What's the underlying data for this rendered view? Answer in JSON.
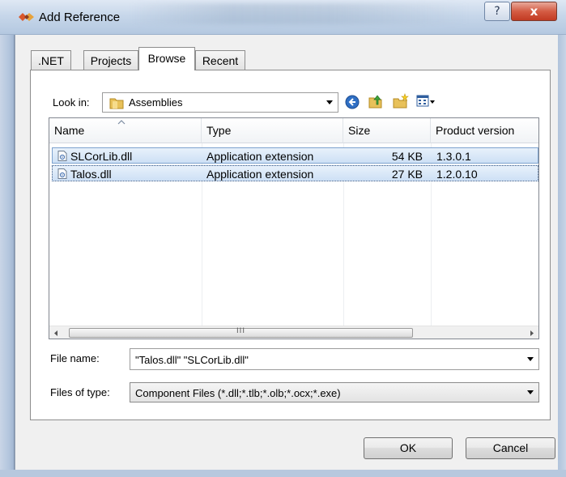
{
  "window": {
    "title": "Add Reference",
    "help_glyph": "?",
    "close_glyph": "x"
  },
  "tabs": [
    {
      "label": ".NET",
      "active": false
    },
    {
      "label": "Projects",
      "active": false
    },
    {
      "label": "Browse",
      "active": true
    },
    {
      "label": "Recent",
      "active": false
    }
  ],
  "look_in": {
    "label": "Look in:",
    "value": "Assemblies"
  },
  "file_list": {
    "columns": [
      "Name",
      "Type",
      "Size",
      "Product version"
    ],
    "rows": [
      {
        "name": "SLCorLib.dll",
        "type": "Application extension",
        "size": "54 KB",
        "version": "1.3.0.1",
        "selected": true
      },
      {
        "name": "Talos.dll",
        "type": "Application extension",
        "size": "27 KB",
        "version": "1.2.0.10",
        "selected": true
      }
    ],
    "scroll_thumb_grip": "III"
  },
  "file_name": {
    "label": "File name:",
    "value": "\"Talos.dll\" \"SLCorLib.dll\""
  },
  "files_of_type": {
    "label": "Files of type:",
    "value": "Component Files (*.dll;*.tlb;*.olb;*.ocx;*.exe)"
  },
  "buttons": {
    "ok": "OK",
    "cancel": "Cancel"
  },
  "colors": {
    "selection": "#cde0f5",
    "selection_border": "#7da2ce",
    "close_button": "#c9442c"
  }
}
